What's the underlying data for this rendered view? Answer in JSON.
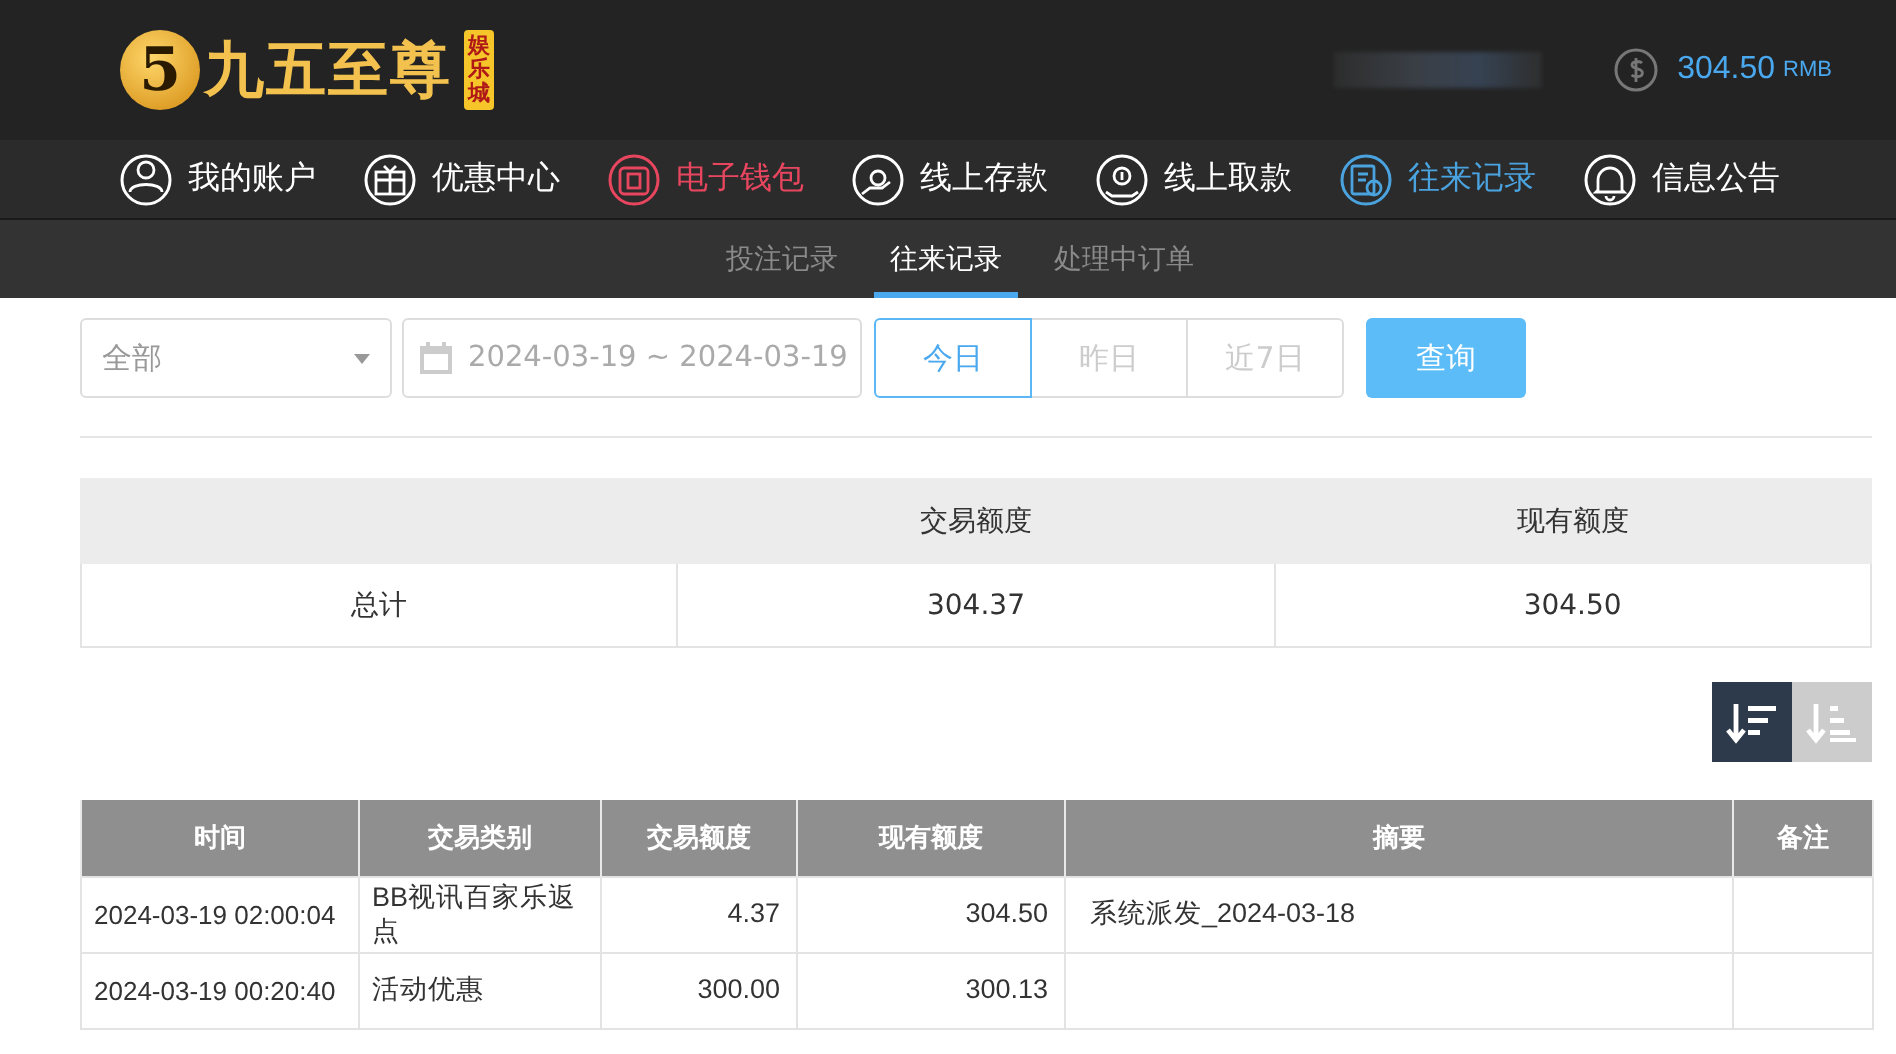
{
  "header": {
    "logo": {
      "badge": "5",
      "name": "九五至尊",
      "tag": "娱乐城"
    },
    "balance": "304.50",
    "currency": "RMB"
  },
  "nav": [
    {
      "label": "我的账户",
      "color": "#ffffff"
    },
    {
      "label": "优惠中心",
      "color": "#ffffff"
    },
    {
      "label": "电子钱包",
      "color": "#e8465f"
    },
    {
      "label": "线上存款",
      "color": "#ffffff"
    },
    {
      "label": "线上取款",
      "color": "#ffffff"
    },
    {
      "label": "往来记录",
      "color": "#4aa3df"
    },
    {
      "label": "信息公告",
      "color": "#ffffff"
    }
  ],
  "subtabs": [
    {
      "label": "投注记录",
      "selected": false
    },
    {
      "label": "往来记录",
      "selected": true
    },
    {
      "label": "处理中订单",
      "selected": false
    }
  ],
  "filters": {
    "type_select": "全部",
    "date_range": "2024-03-19 ~ 2024-03-19",
    "quick_dates": [
      {
        "label": "今日",
        "selected": true
      },
      {
        "label": "昨日",
        "selected": false
      },
      {
        "label": "近7日",
        "selected": false
      }
    ],
    "query_button": "查询"
  },
  "summary": {
    "columns": [
      "",
      "交易额度",
      "现有额度"
    ],
    "rows": [
      [
        "总计",
        "304.37",
        "304.50"
      ]
    ]
  },
  "sort_buttons": [
    {
      "selected": true
    },
    {
      "selected": false
    }
  ],
  "records": {
    "columns": [
      "时间",
      "交易类别",
      "交易额度",
      "现有额度",
      "摘要",
      "备注"
    ],
    "rows": [
      [
        "2024-03-19 02:00:04",
        "BB视讯百家乐返点",
        "4.37",
        "304.50",
        "系统派发_2024-03-18",
        ""
      ],
      [
        "2024-03-19 00:20:40",
        "活动优惠",
        "300.00",
        "300.13",
        "",
        ""
      ]
    ]
  }
}
